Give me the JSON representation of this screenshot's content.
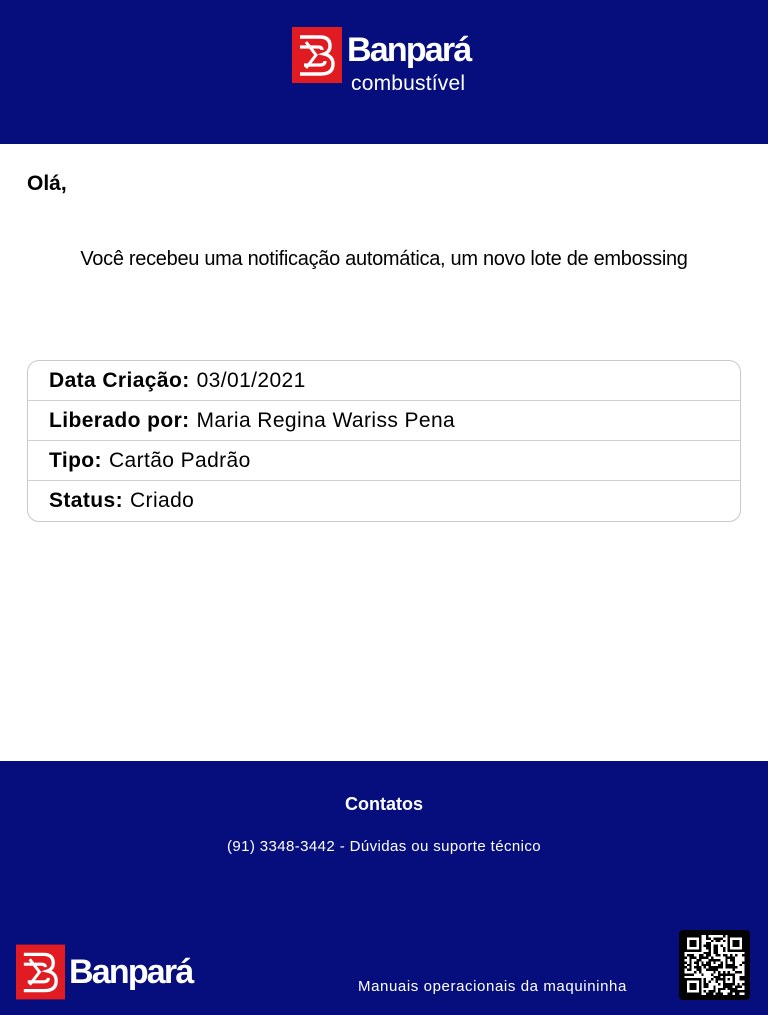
{
  "header": {
    "brand_name": "Banpará",
    "brand_sub": "combustível"
  },
  "greeting": "Olá,",
  "intro": "Você recebeu uma notificação automática, um novo lote de embossing",
  "details": {
    "created": {
      "label": "Data Criação:",
      "value": "03/01/2021"
    },
    "released_by": {
      "label": "Liberado por:",
      "value": "Maria Regina Wariss Pena"
    },
    "type": {
      "label": "Tipo:",
      "value": "Cartão Padrão"
    },
    "status": {
      "label": "Status:",
      "value": "Criado"
    }
  },
  "footer": {
    "contacts_title": "Contatos",
    "contacts_line": "(91) 3348-3442 - Dúvidas ou suporte técnico",
    "brand_name": "Banpará",
    "manuals_link": "Manuais operacionais da maquininha"
  },
  "colors": {
    "brand_blue": "#050e7c",
    "brand_red": "#e11b22",
    "background": "#ffffff"
  },
  "icons": {
    "logo": "banpara-logo-mark",
    "qr": "qr-code-icon"
  }
}
